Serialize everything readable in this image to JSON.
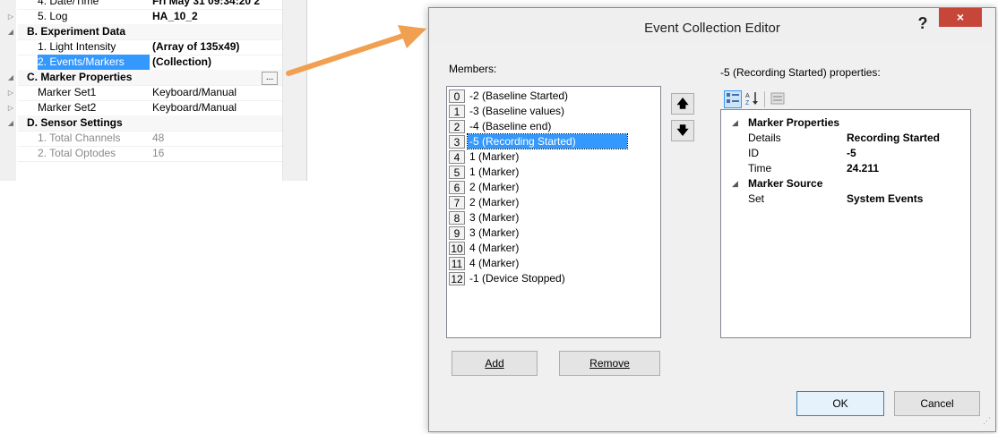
{
  "property_grid": {
    "rows": [
      {
        "name": "4. Date/Time",
        "value": "Fri May 31 09:34:20 2"
      },
      {
        "name": "5. Log",
        "value": "HA_10_2"
      },
      {
        "name": "B. Experiment Data"
      },
      {
        "name": "1. Light Intensity",
        "value": "(Array of 135x49)"
      },
      {
        "name": "2. Events/Markers",
        "value": "(Collection)"
      },
      {
        "name": "C. Marker Properties"
      },
      {
        "name": "Marker Set1",
        "value": "Keyboard/Manual"
      },
      {
        "name": "Marker Set2",
        "value": "Keyboard/Manual"
      },
      {
        "name": "D. Sensor Settings"
      },
      {
        "name": "1. Total Channels",
        "value": "48"
      },
      {
        "name": "2. Total Optodes",
        "value": "16"
      }
    ],
    "ellipsis": "..."
  },
  "dialog": {
    "title": "Event Collection Editor",
    "help": "?",
    "close": "×",
    "members_label": "Members:",
    "members": [
      {
        "index": "0",
        "text": "-2 (Baseline Started)"
      },
      {
        "index": "1",
        "text": "-3 (Baseline values)"
      },
      {
        "index": "2",
        "text": "-4 (Baseline end)"
      },
      {
        "index": "3",
        "text": "-5 (Recording Started)",
        "selected": true
      },
      {
        "index": "4",
        "text": "1 (Marker)"
      },
      {
        "index": "5",
        "text": "1 (Marker)"
      },
      {
        "index": "6",
        "text": "2 (Marker)"
      },
      {
        "index": "7",
        "text": "2 (Marker)"
      },
      {
        "index": "8",
        "text": "3 (Marker)"
      },
      {
        "index": "9",
        "text": "3 (Marker)"
      },
      {
        "index": "10",
        "text": "4 (Marker)"
      },
      {
        "index": "11",
        "text": "4 (Marker)"
      },
      {
        "index": "12",
        "text": "-1 (Device Stopped)"
      }
    ],
    "up_arrow": "🡅",
    "down_arrow": "🡇",
    "add_button": "Add",
    "remove_button": "Remove",
    "properties_label": "-5 (Recording Started) properties:",
    "properties": {
      "cat1": "Marker Properties",
      "details_name": "Details",
      "details_value": "Recording Started",
      "id_name": "ID",
      "id_value": "-5",
      "time_name": "Time",
      "time_value": "24.211",
      "cat2": "Marker Source",
      "set_name": "Set",
      "set_value": "System Events"
    },
    "ok_button": "OK",
    "cancel_button": "Cancel"
  },
  "colors": {
    "accent": "#3399ff",
    "close": "#c7463a",
    "arrow": "#f0a050"
  }
}
